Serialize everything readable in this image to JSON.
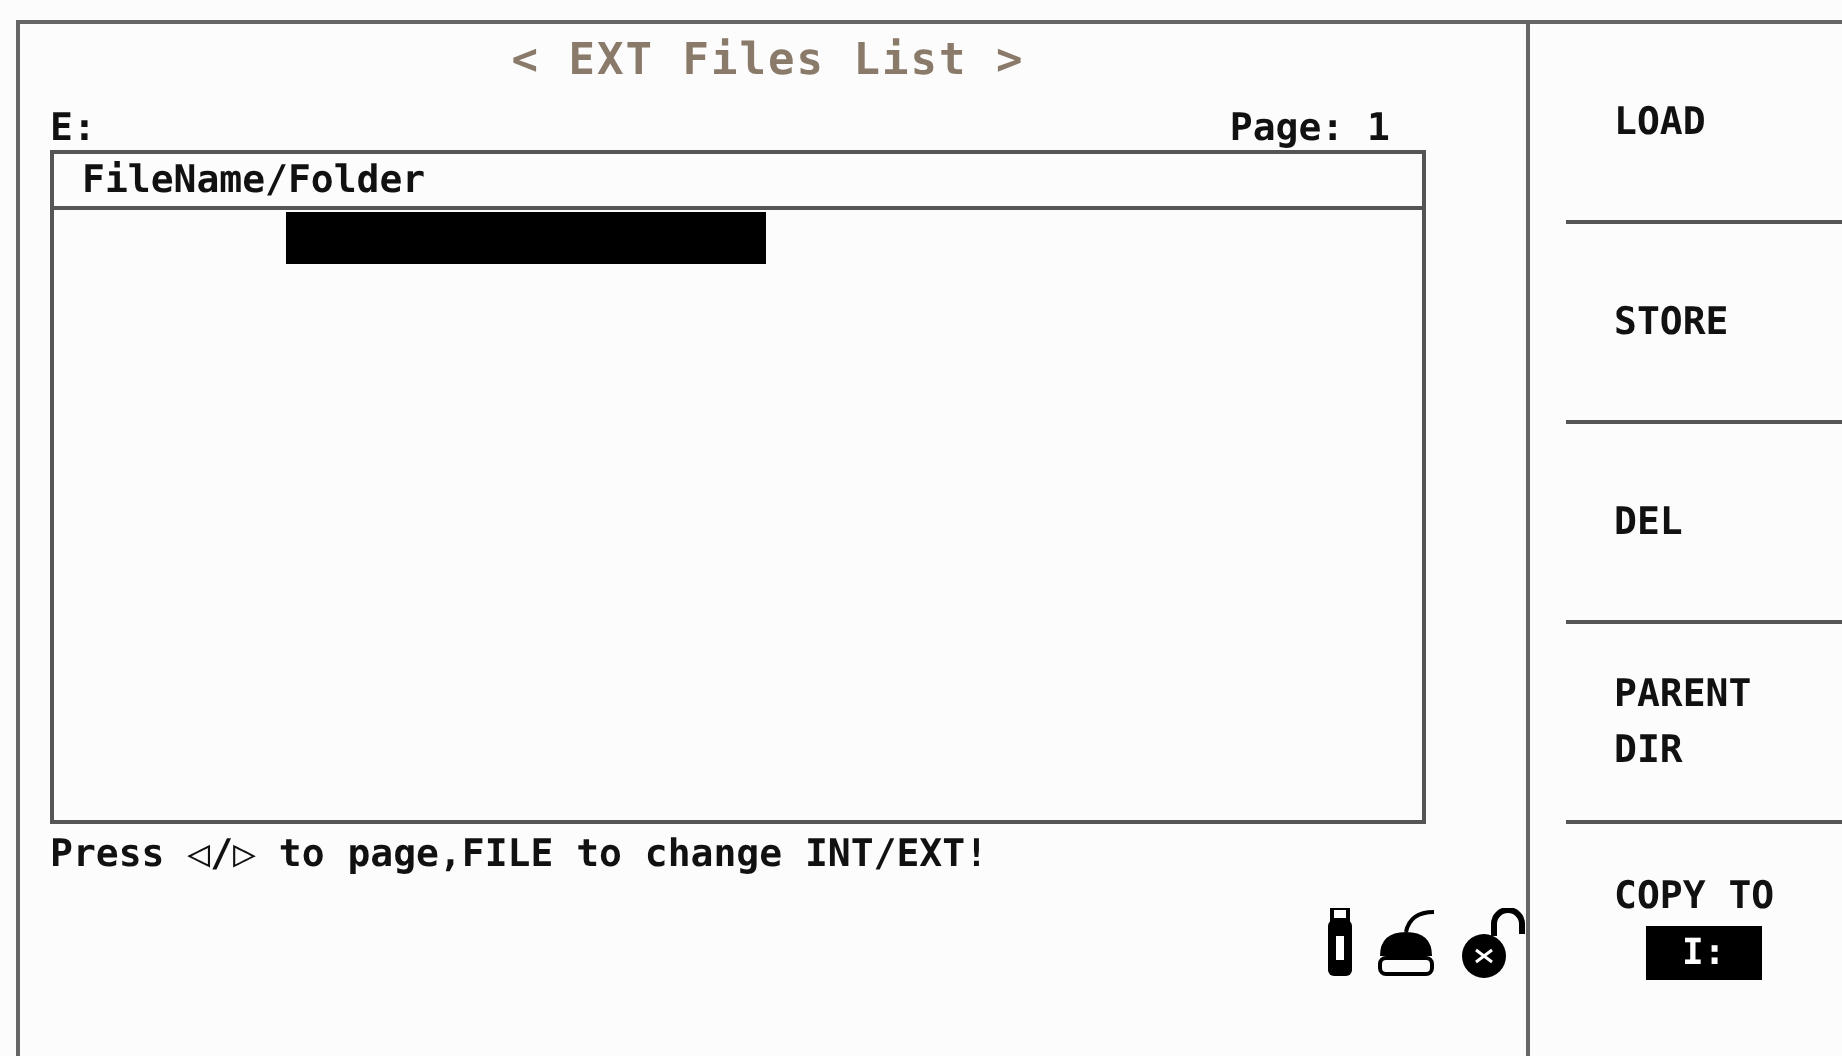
{
  "header": {
    "title": "< EXT Files List >",
    "drive": "E:",
    "page": "Page: 1"
  },
  "table": {
    "columns": [
      "FileName/Folder"
    ],
    "rows": [
      {
        "selected": true
      }
    ]
  },
  "hint": "Press ◁/▷ to page,FILE to change INT/EXT!",
  "softkeys": [
    {
      "kind": "label",
      "label": "LOAD"
    },
    {
      "kind": "label",
      "label": "STORE"
    },
    {
      "kind": "label",
      "label": "DEL"
    },
    {
      "kind": "label",
      "label": "PARENT\nDIR"
    },
    {
      "kind": "target",
      "label": "COPY TO",
      "value": "I:"
    }
  ]
}
